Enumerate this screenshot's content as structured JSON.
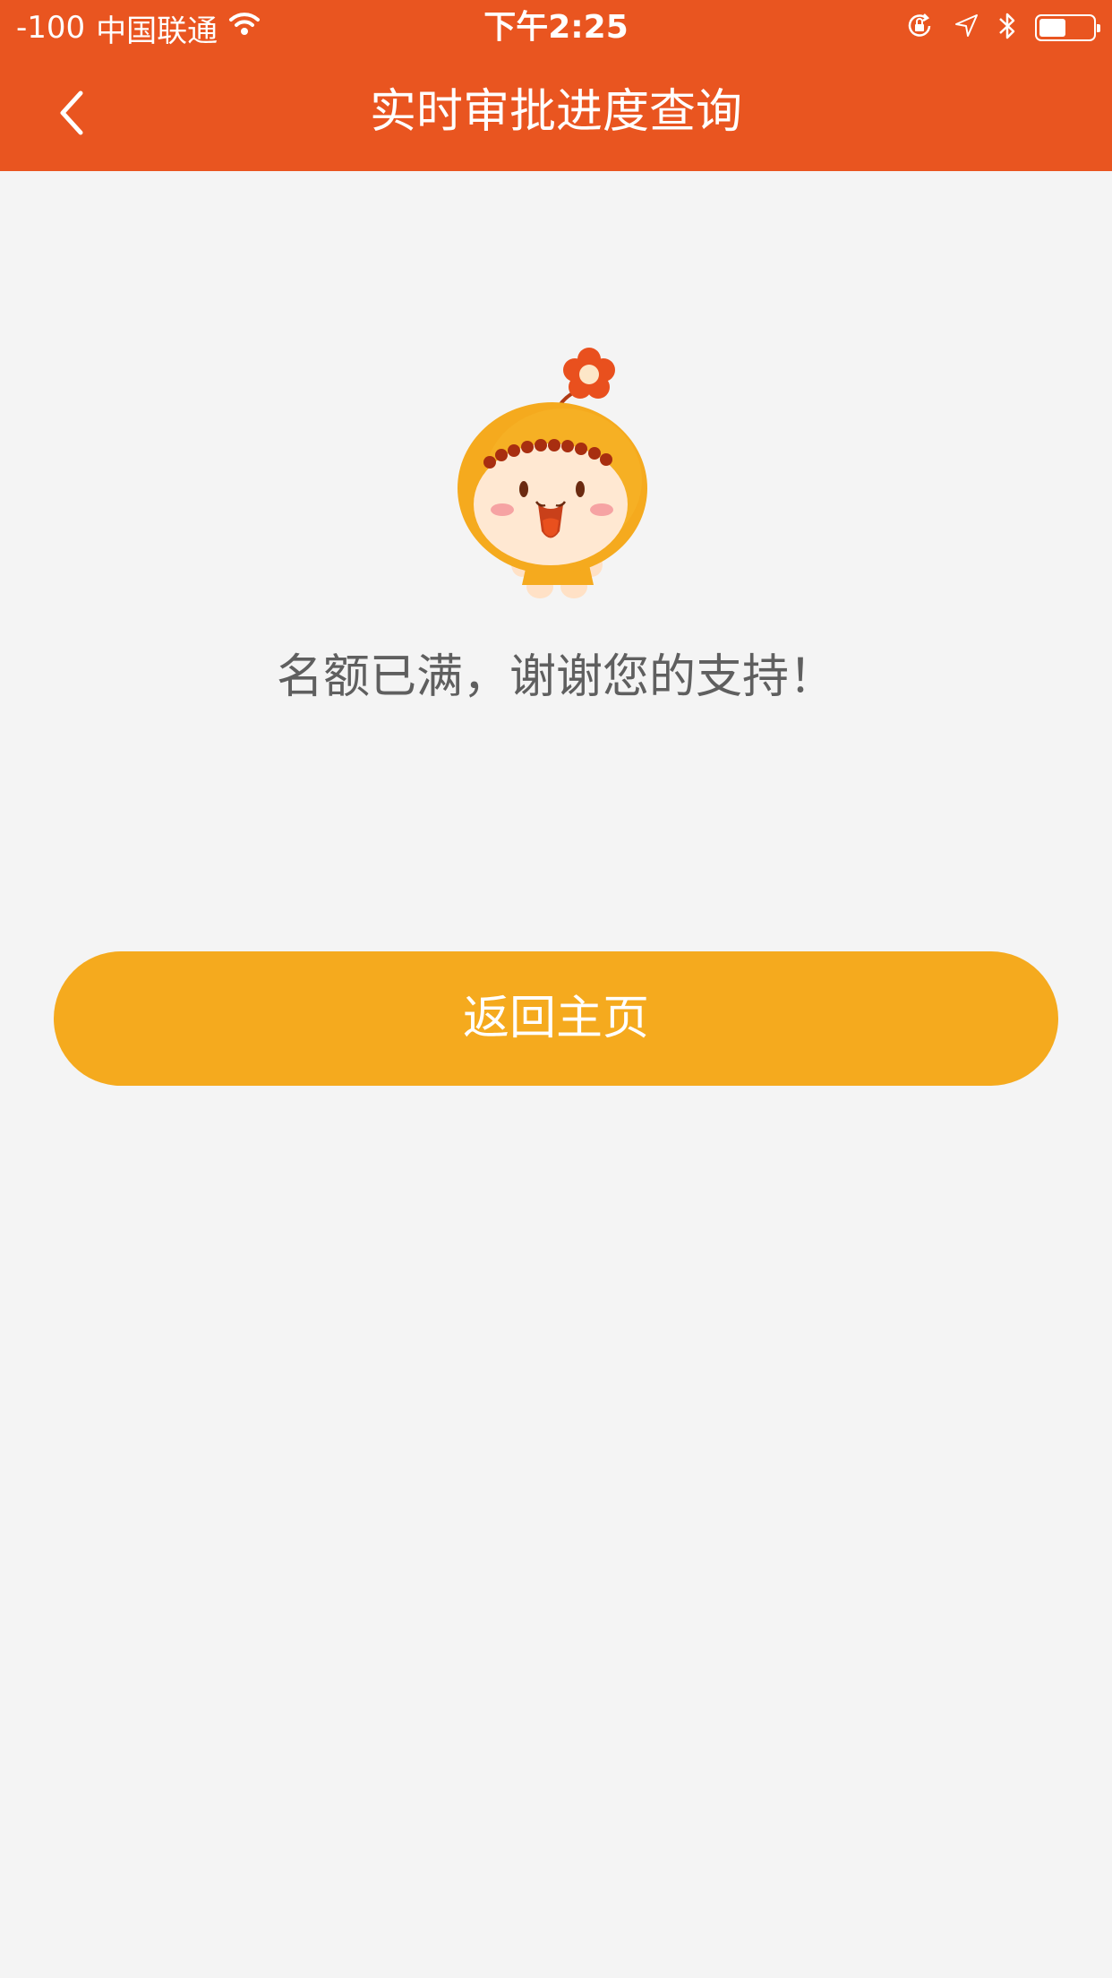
{
  "status_bar": {
    "signal": "-100",
    "carrier": "中国联通",
    "time": "下午2:25",
    "icons": [
      "wifi-icon",
      "rotation-lock-icon",
      "location-arrow-icon",
      "bluetooth-icon",
      "battery-icon"
    ],
    "battery_level": 0.5
  },
  "nav": {
    "title": "实时审批进度查询",
    "back_icon": "chevron-left-icon"
  },
  "main": {
    "illustration": "mascot-illustration",
    "message": "名额已满，谢谢您的支持！",
    "home_button_label": "返回主页"
  },
  "colors": {
    "header_bg": "#e95520",
    "page_bg": "#f4f4f4",
    "button_bg": "#f5aa1e",
    "message_text": "#5f5f5f"
  }
}
